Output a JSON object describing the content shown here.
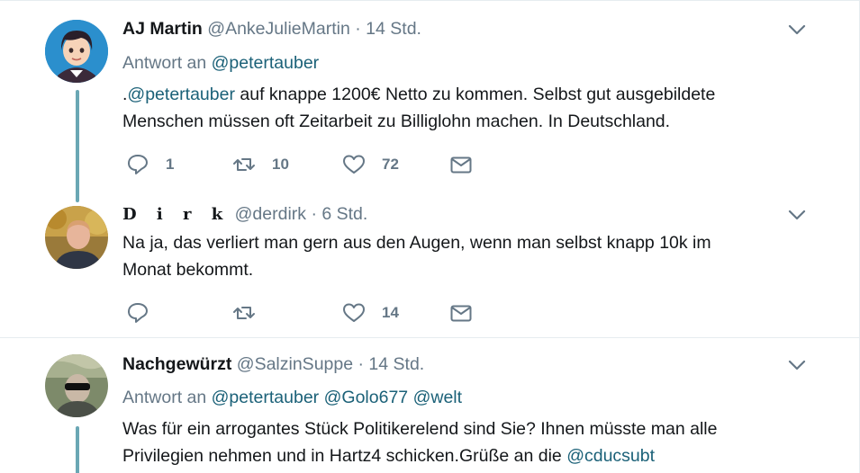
{
  "tweets": [
    {
      "fullname": "AJ Martin",
      "username": "@AnkeJulieMartin",
      "dot": "·",
      "time": "14 Std.",
      "reply_prefix": "Antwort an",
      "reply_to": [
        "@petertauber"
      ],
      "text_link_prefix": ".",
      "text_link": "@petertauber",
      "text_line1_rest": " auf knappe 1200€ Netto zu kommen. Selbst gut ausgebildete",
      "text_line2": "Menschen müssen oft Zeitarbeit zu Billiglohn machen. In Deutschland.",
      "reply_count": "1",
      "retweet_count": "10",
      "like_count": "72"
    },
    {
      "fullname": "D i r k",
      "username": "@derdirk",
      "dot": "·",
      "time": "6 Std.",
      "text_line1": "Na ja, das verliert man gern aus den Augen, wenn man selbst knapp 10k im",
      "text_line2": "Monat bekommt.",
      "like_count": "14"
    },
    {
      "fullname": "Nachgewürzt",
      "username": "@SalzinSuppe",
      "dot": "·",
      "time": "14 Std.",
      "reply_prefix": "Antwort an",
      "reply_to": [
        "@petertauber",
        "@Golo677",
        "@welt"
      ],
      "text_line1": "Was für ein arrogantes Stück Politikerelend sind Sie? Ihnen müsste man alle",
      "text_line2_prefix": "Privilegien nehmen und in Hartz4 schicken.Grüße an die ",
      "text_line2_link": "@cducsubt"
    }
  ],
  "icons": {
    "reply": "reply-icon",
    "retweet": "retweet-icon",
    "like": "heart-icon",
    "dm": "envelope-icon",
    "caret": "chevron-down-icon"
  },
  "colors": {
    "link": "#1b6178",
    "muted": "#657786",
    "thread_line": "#6aa7b4",
    "divider": "#e6ecf0"
  }
}
